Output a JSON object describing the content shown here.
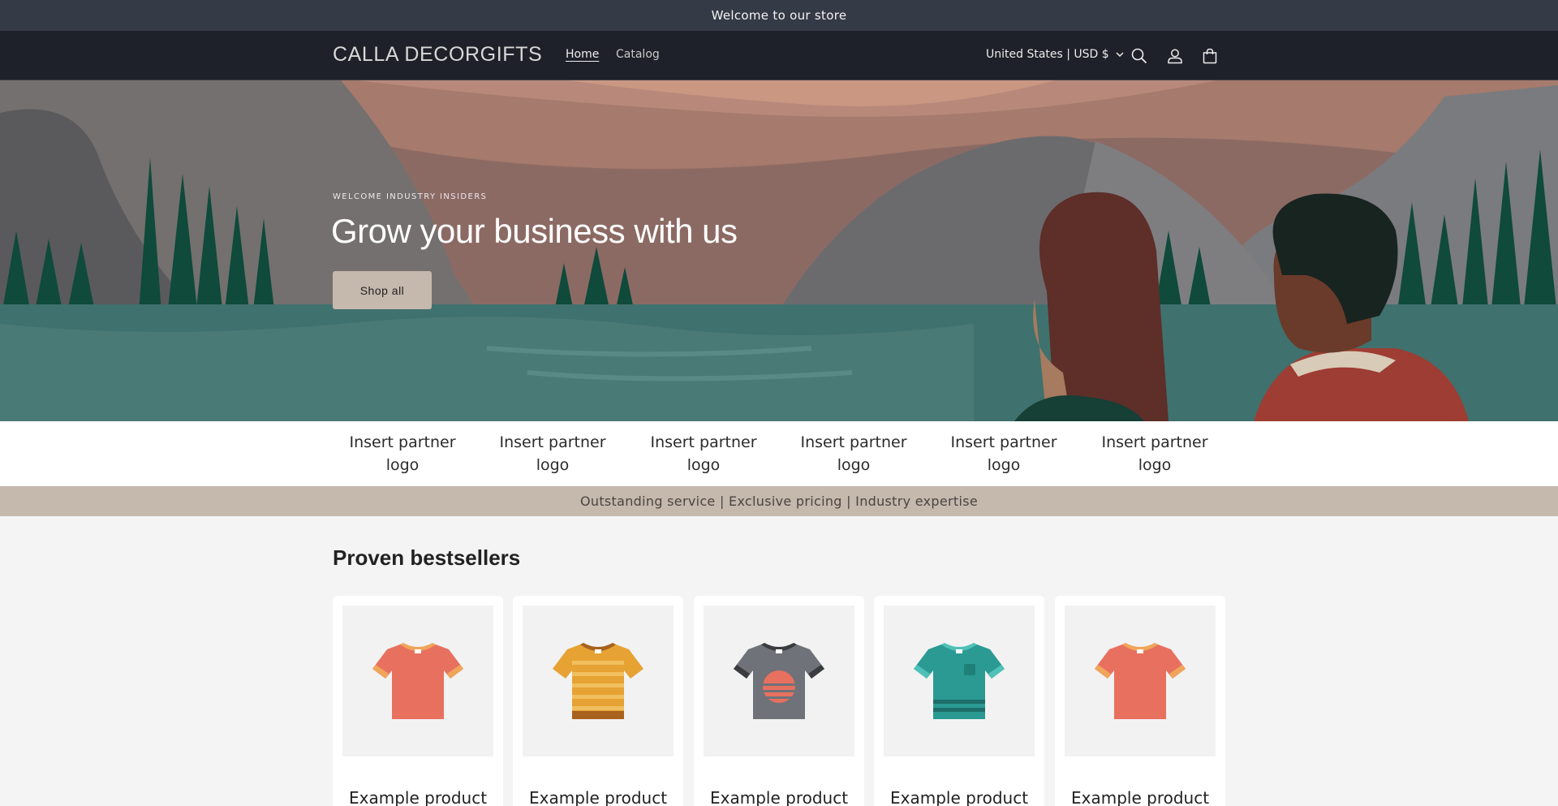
{
  "announcement": "Welcome to our store",
  "header": {
    "logo": "CALLA DECORGIFTS",
    "nav": {
      "home": "Home",
      "catalog": "Catalog"
    },
    "locale": "United States | USD $",
    "icons": [
      "chevron-down-icon",
      "search-icon",
      "account-icon",
      "cart-icon"
    ]
  },
  "hero": {
    "subheading": "WELCOME INDUSTRY INSIDERS",
    "heading": "Grow your business with us",
    "button": "Shop all"
  },
  "partners": [
    {
      "line1": "Insert partner",
      "line2": "logo"
    },
    {
      "line1": "Insert partner",
      "line2": "logo"
    },
    {
      "line1": "Insert partner",
      "line2": "logo"
    },
    {
      "line1": "Insert partner",
      "line2": "logo"
    },
    {
      "line1": "Insert partner",
      "line2": "logo"
    },
    {
      "line1": "Insert partner",
      "line2": "logo"
    }
  ],
  "usp": "Outstanding service | Exclusive pricing | Industry expertise",
  "bestsellers": {
    "title": "Proven bestsellers",
    "products": [
      {
        "name": "Example product",
        "shirt_color": "#e8705f",
        "style": "plain"
      },
      {
        "name": "Example product",
        "shirt_color": "#e6a233",
        "style": "striped"
      },
      {
        "name": "Example product",
        "shirt_color": "#6f7278",
        "style": "sunset"
      },
      {
        "name": "Example product",
        "shirt_color": "#2a9a93",
        "style": "pocket"
      },
      {
        "name": "Example product",
        "shirt_color": "#e8705f",
        "style": "plain"
      }
    ]
  },
  "colors": {
    "announcement_bg": "#343a46",
    "header_bg": "#1e2129",
    "accent": "#c5b8ad",
    "page_bg": "#f4f4f4"
  }
}
